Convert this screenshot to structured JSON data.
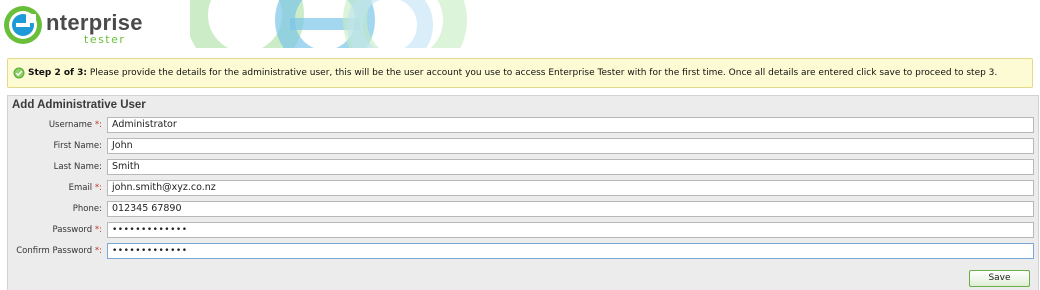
{
  "header": {
    "logo_line1": "nterprise",
    "logo_line2": "tester",
    "logo_mark_icon": "enterprise-tester-logo-icon"
  },
  "banner": {
    "icon": "check-circle-icon",
    "step_label": "Step 2 of 3:",
    "message": " Please provide the details for the administrative user, this will be the user account you use to access Enterprise Tester with for the first time. Once all details are entered click save to proceed to step 3."
  },
  "form": {
    "title": "Add Administrative User",
    "required_marker": "*:",
    "fields": [
      {
        "label": "Username",
        "required": true,
        "value": "Administrator"
      },
      {
        "label": "First Name:",
        "required": false,
        "value": "John"
      },
      {
        "label": "Last Name:",
        "required": false,
        "value": "Smith"
      },
      {
        "label": "Email",
        "required": true,
        "value": "john.smith@xyz.co.nz"
      },
      {
        "label": "Phone:",
        "required": false,
        "value": "012345 67890"
      },
      {
        "label": "Password",
        "required": true,
        "value": "•••••••••••••"
      },
      {
        "label": "Confirm Password",
        "required": true,
        "value": "•••••••••••••"
      }
    ],
    "save_label": "Save"
  },
  "colors": {
    "brand_green": "#6abf3a",
    "brand_blue": "#1e9ad6",
    "banner_bg": "#fdfbd4",
    "panel_bg": "#ececec"
  }
}
